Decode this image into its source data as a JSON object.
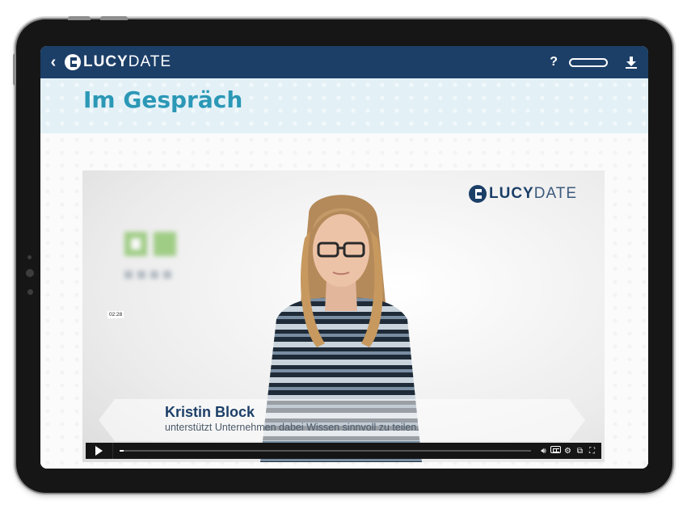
{
  "app": {
    "logo_strong": "LUCY",
    "logo_light": "DATE",
    "help_label": "?",
    "progress_fraction": 0.0
  },
  "page": {
    "title": "Im Gespräch"
  },
  "video": {
    "logo_strong": "LUCY",
    "logo_light": "DATE",
    "lower_third": {
      "name": "Kristin Block",
      "subtitle": "unterstützt Unternehmen dabei Wissen sinnvoll zu teilen."
    },
    "current_time": "02:28",
    "played_fraction": 0.01
  },
  "colors": {
    "header_bg": "#1c3f68",
    "title_color": "#2b98b6",
    "heading_band_bg": "#e3f1f7"
  },
  "icons": {
    "back": "chevron-left-icon",
    "download": "download-icon",
    "volume": "volume-icon",
    "captions": "closed-captions-icon",
    "settings": "gear-icon",
    "pip": "picture-in-picture-icon",
    "fullscreen": "fullscreen-icon"
  }
}
